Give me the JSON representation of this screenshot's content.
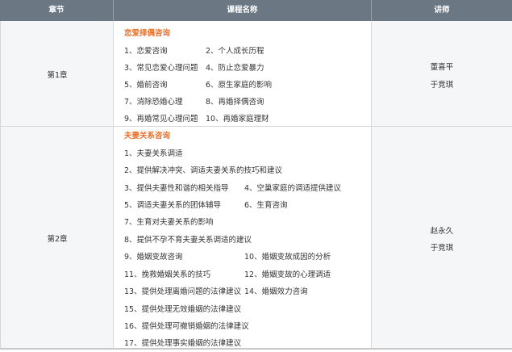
{
  "header": {
    "chapter": "章节",
    "course": "课程名称",
    "lecturer": "讲师"
  },
  "rows": [
    {
      "chapter": "第1章",
      "section_title": "恋爱择偶咨询",
      "items": [
        "1、恋爱咨询",
        "2、个人成长历程",
        "3、常见恋爱心理问题",
        "4、防止恋爱暴力",
        "5、婚前咨询",
        "6、原生家庭的影响",
        "7、消除恐婚心理",
        "8、再婚择偶咨询",
        "9、再婚常见心理问题",
        "10、再婚家庭理财"
      ],
      "lecturers": [
        "董喜平",
        "于竞琪"
      ]
    },
    {
      "chapter": "第2章",
      "section_title": "夫妻关系咨询",
      "items": [
        "1、夫妻关系调适",
        "2、提供解决冲突、调适夫妻关系的技巧和建议",
        "3、提供夫妻性和谐的相关指导",
        "4、空巢家庭的调适提供建议",
        "5、调适夫妻关系的团体辅导",
        "6、生育咨询",
        "7、生育对夫妻关系的影响",
        "8、提供不孕不育夫妻关系调适的建议",
        "9、婚姻变故咨询",
        "10、婚姻变故成因的分析",
        "11、挽救婚姻关系的技巧",
        "12、婚姻变故的心理调适",
        "13、提供处理离婚问题的法律建议",
        "14、婚姻效力咨询",
        "15、提供处理无效婚姻的法律建议",
        "16、提供处理可撤销婚姻的法律建议",
        "17、提供处理事实婚姻的法律建议"
      ],
      "lecturers": [
        "赵永久",
        "于竞琪"
      ]
    }
  ]
}
